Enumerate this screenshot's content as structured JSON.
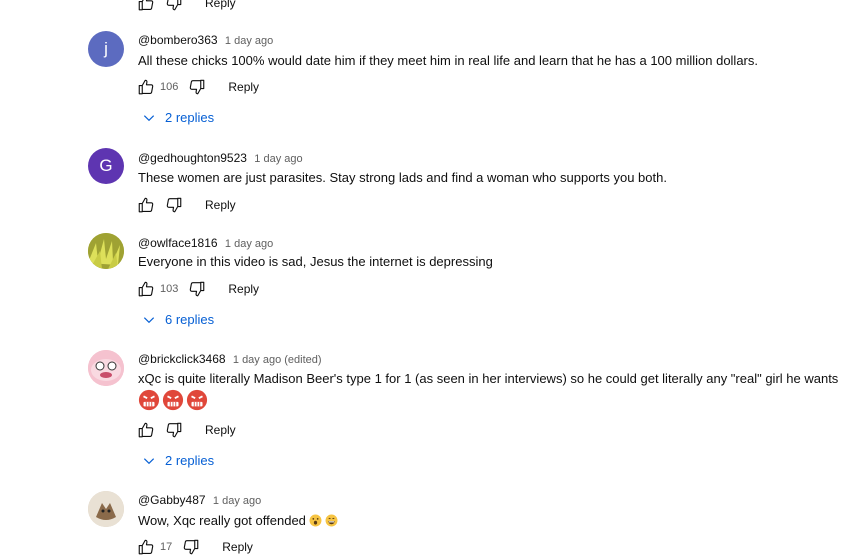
{
  "reply_label": "Reply",
  "comments": [
    {
      "author": "@bombero363",
      "time": "1 day ago",
      "avatar_letter": "j",
      "avatar_color": "#5c6bc0",
      "text": "All these chicks 100% would date him if they meet him in real life and learn that he has a 100 million dollars.",
      "likes": "106",
      "replies": "2 replies"
    },
    {
      "author": "@gedhoughton9523",
      "time": "1 day ago",
      "avatar_letter": "G",
      "avatar_color": "#5e35b1",
      "text": "These women are just parasites. Stay strong lads and find a woman who supports you both."
    },
    {
      "author": "@owlface1816",
      "time": "1 day ago",
      "avatar_color": "#b5b83a",
      "text": "Everyone in this video is sad, Jesus the internet is depressing",
      "likes": "103",
      "replies": "6 replies"
    },
    {
      "author": "@brickclick3468",
      "time": "1 day ago (edited)",
      "avatar_color": "#f2b8c6",
      "text": "xQc is quite literally Madison Beer's type 1 for 1 (as seen in her interviews) so he could get literally any \"real\" girl he wants",
      "emojis": [
        "angry-face-emoji",
        "angry-face-emoji",
        "angry-face-emoji"
      ],
      "replies": "2 replies"
    },
    {
      "author": "@Gabby487",
      "time": "1 day ago",
      "avatar_color": "#d8cbb8",
      "text": "Wow, Xqc really got offended",
      "text_emojis": [
        "surprised-face-emoji",
        "grinning-face-emoji"
      ],
      "likes": "17"
    }
  ]
}
